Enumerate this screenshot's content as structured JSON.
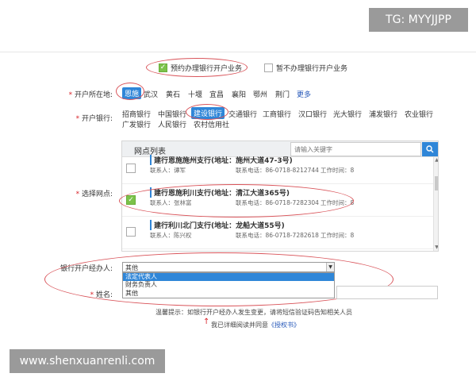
{
  "watermarks": {
    "top": "TG: MYYJJPP",
    "bottom": "www.shenxuanrenli.com"
  },
  "business_choice": {
    "option_yes": "预约办理银行开户业务",
    "option_no": "暂不办理银行开户业务",
    "selected": "yes"
  },
  "location": {
    "label": "开户所在地:",
    "options": [
      "恩施",
      "武汉",
      "黄石",
      "十堰",
      "宜昌",
      "襄阳",
      "鄂州",
      "荆门"
    ],
    "selected": "恩施",
    "more": "更多"
  },
  "bank": {
    "label": "开户银行:",
    "row1": [
      "招商银行",
      "中国银行",
      "建设银行",
      "交通银行",
      "工商银行",
      "汉口银行",
      "光大银行",
      "浦发银行",
      "农业银行"
    ],
    "row2": [
      "广发银行",
      "人民银行",
      "农村信用社"
    ],
    "selected": "建设银行"
  },
  "branch_select": {
    "label": "选择网点:",
    "panel_title": "网点列表",
    "search_placeholder": "请输入关键字",
    "branches": [
      {
        "name": "建行恩施施州支行(地址：施州大道47-3号)",
        "contact": "联系人：谭军",
        "phone": "联系电话：86-0718-8212744",
        "hours": "工作时间：8",
        "checked": false
      },
      {
        "name": "建行恩施利川支行(地址：清江大道365号)",
        "contact": "联系人：张林富",
        "phone": "联系电话：86-0718-7282304",
        "hours": "工作时间：8",
        "checked": true
      },
      {
        "name": "建行利川北门支行(地址：龙船大道55号)",
        "contact": "联系人：陈兴权",
        "phone": "联系电话：86-0718-7282618",
        "hours": "工作时间：8",
        "checked": false
      }
    ]
  },
  "agent": {
    "label": "银行开户经办人:",
    "current": "其他",
    "options": [
      "法定代表人",
      "财务负责人",
      "其他"
    ],
    "highlighted": "法定代表人"
  },
  "name_field": {
    "label": "姓名:"
  },
  "tip": "温馨提示：如银行开户经办人发生变更，请将短信验证码告知相关人员",
  "agreement": {
    "text": "我已详细阅读并同意",
    "link": "《授权书》"
  },
  "colors": {
    "accent": "#2f86d8",
    "check": "#7cc24a",
    "annotation": "#d9545a",
    "required": "#d9242a"
  }
}
